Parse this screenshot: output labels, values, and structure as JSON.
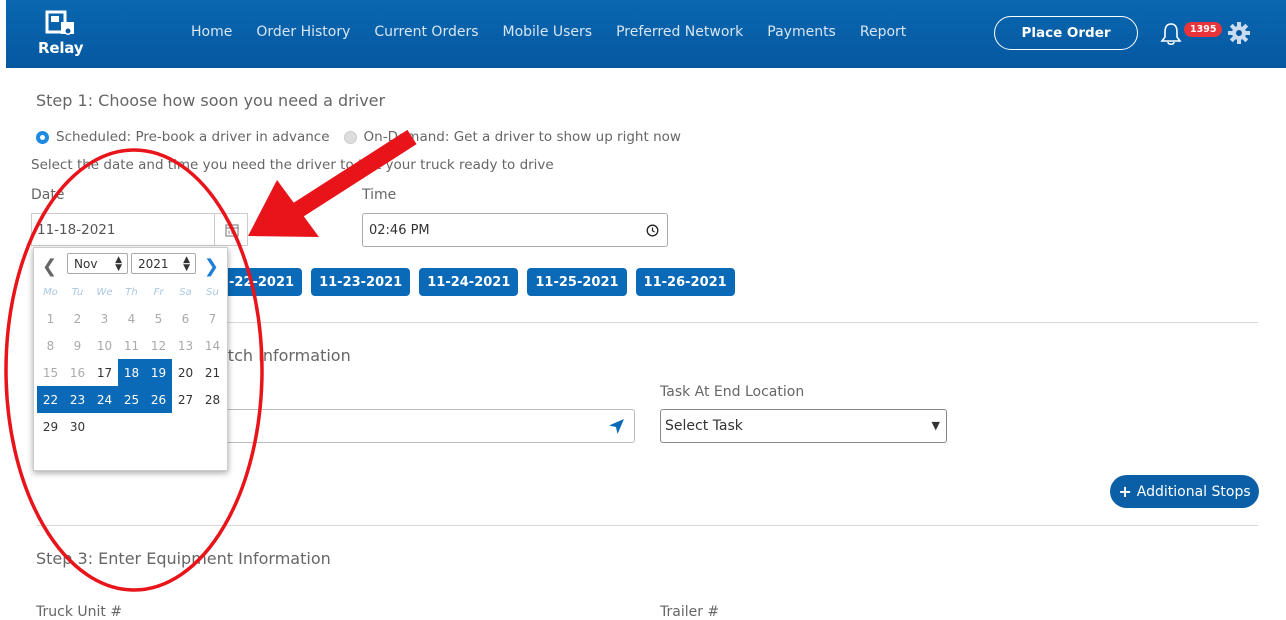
{
  "header": {
    "logo_text": "Relay",
    "nav": [
      "Home",
      "Order History",
      "Current Orders",
      "Mobile Users",
      "Preferred Network",
      "Payments",
      "Report"
    ],
    "place_order_label": "Place Order",
    "notification_count": "1395"
  },
  "step1": {
    "title": "Step 1: Choose how soon you need a driver",
    "scheduled_label": "Scheduled: Pre-book a driver in advance",
    "ondemand_label": "On-Demand: Get a driver to show up right now",
    "hint": "Select the date and time you need the driver to t at your truck ready to drive",
    "date_label": "Date",
    "date_value": "11-18-2021",
    "time_label": "Time",
    "time_value": "02:46 PM",
    "quick_dates": [
      "-22-2021",
      "11-23-2021",
      "11-24-2021",
      "11-25-2021",
      "11-26-2021"
    ]
  },
  "datepicker": {
    "month": "Nov",
    "year": "2021",
    "weekdays": [
      "Mo",
      "Tu",
      "We",
      "Th",
      "Fr",
      "Sa",
      "Su"
    ],
    "rows": [
      [
        "1",
        "2",
        "3",
        "4",
        "5",
        "6",
        "7"
      ],
      [
        "8",
        "9",
        "10",
        "11",
        "12",
        "13",
        "14"
      ],
      [
        "15",
        "16",
        "17",
        "18",
        "19",
        "20",
        "21"
      ],
      [
        "22",
        "23",
        "24",
        "25",
        "26",
        "27",
        "28"
      ],
      [
        "29",
        "30",
        "",
        "",
        "",
        "",
        ""
      ]
    ],
    "muted_days": [
      "1",
      "2",
      "3",
      "4",
      "5",
      "6",
      "7",
      "8",
      "9",
      "10",
      "11",
      "12",
      "13",
      "14",
      "15",
      "16"
    ],
    "highlighted_days": [
      "18",
      "19",
      "22",
      "23",
      "24",
      "25",
      "26"
    ]
  },
  "step2": {
    "title_partial": "atch Information",
    "task_label": "Task At End Location",
    "task_value": "Select Task",
    "additional_stops_label": "Additional Stops"
  },
  "step3": {
    "title": "Step 3: Enter Equipment Information",
    "truck_label": "Truck Unit #",
    "trailer_label": "Trailer #"
  },
  "colors": {
    "header_blue": "#0558a0",
    "chip_blue": "#0a6ab7",
    "badge_red": "#e8343a",
    "annotation_red": "#e8141a"
  }
}
